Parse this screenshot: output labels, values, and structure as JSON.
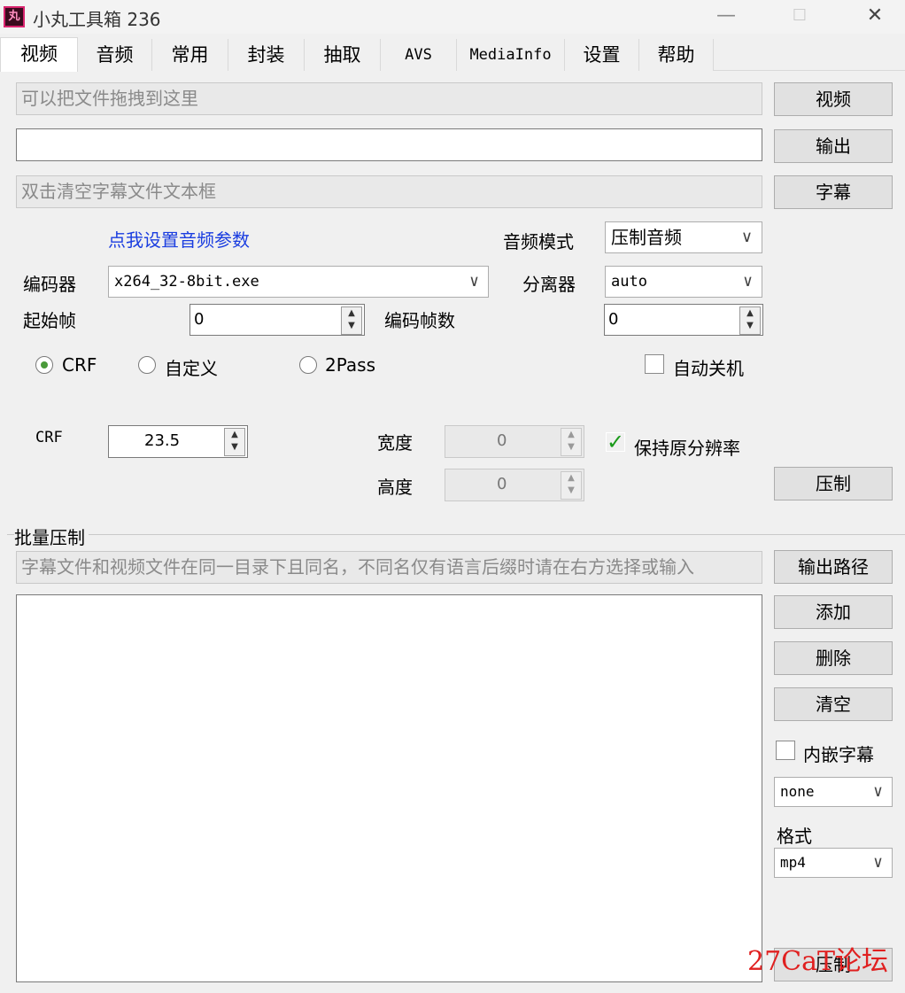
{
  "window": {
    "title": "小丸工具箱 236",
    "app_icon": "丸",
    "min": "—",
    "max": "☐",
    "close": "✕"
  },
  "tabs": [
    {
      "label": "视频",
      "active": true
    },
    {
      "label": "音频"
    },
    {
      "label": "常用"
    },
    {
      "label": "封装"
    },
    {
      "label": "抽取"
    },
    {
      "label": "AVS"
    },
    {
      "label": "MediaInfo"
    },
    {
      "label": "设置"
    },
    {
      "label": "帮助"
    }
  ],
  "video": {
    "drop_placeholder": "可以把文件拖拽到这里",
    "video_btn": "视频",
    "output_value": "",
    "output_btn": "输出",
    "subtitle_placeholder": "双击清空字幕文件文本框",
    "subtitle_btn": "字幕",
    "audio_link": "点我设置音频参数",
    "audio_mode_label": "音频模式",
    "audio_mode_value": "压制音频",
    "encoder_label": "编码器",
    "encoder_value": "x264_32-8bit.exe",
    "splitter_label": "分离器",
    "splitter_value": "auto",
    "start_frame_label": "起始帧",
    "start_frame_value": "0",
    "frame_count_label": "编码帧数",
    "frame_count_value": "0",
    "mode_crf": "CRF",
    "mode_custom": "自定义",
    "mode_2pass": "2Pass",
    "auto_shutdown": "自动关机",
    "crf_label": "CRF",
    "crf_value": "23.5",
    "width_label": "宽度",
    "width_value": "0",
    "height_label": "高度",
    "height_value": "0",
    "keep_res": "保持原分辨率",
    "encode_btn": "压制"
  },
  "batch": {
    "group_title": "批量压制",
    "hint_placeholder": "字幕文件和视频文件在同一目录下且同名，不同名仅有语言后缀时请在右方选择或输入",
    "output_path_btn": "输出路径",
    "add_btn": "添加",
    "delete_btn": "删除",
    "clear_btn": "清空",
    "embed_sub": "内嵌字幕",
    "lang_value": "none",
    "format_label": "格式",
    "format_value": "mp4",
    "encode_btn": "压制"
  },
  "watermark": "27CaT论坛",
  "colors": {
    "link": "#1a3de0",
    "check": "#1a9a1a",
    "watermark": "#e02020"
  }
}
